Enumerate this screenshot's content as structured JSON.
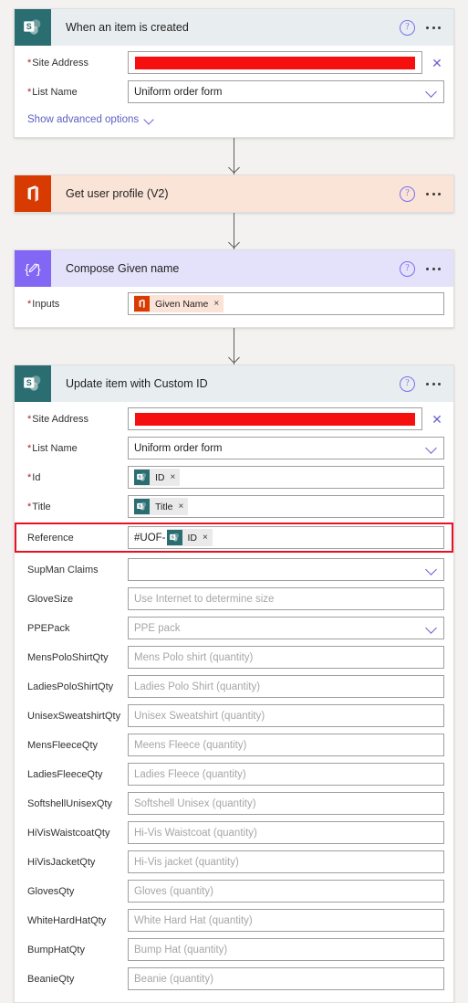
{
  "flow": {
    "steps": [
      {
        "id": "trigger",
        "title": "When an item is created",
        "connector": "sharepoint",
        "icon": "sharepoint-icon",
        "help_icon": "help-icon",
        "more_icon": "more-options-icon",
        "fields": [
          {
            "label": "Site Address",
            "required": true,
            "type": "redacted",
            "value": "",
            "placeholder": "",
            "clear_label": "✕"
          },
          {
            "label": "List Name",
            "required": true,
            "type": "dropdown",
            "value": "Uniform order form",
            "placeholder": ""
          }
        ],
        "advanced_label": "Show advanced options"
      },
      {
        "id": "get-user-profile",
        "title": "Get user profile (V2)",
        "connector": "office365",
        "icon": "office-365-icon",
        "help_icon": "help-icon",
        "more_icon": "more-options-icon",
        "fields": []
      },
      {
        "id": "compose-given-name",
        "title": "Compose Given name",
        "connector": "compose",
        "icon": "compose-icon",
        "help_icon": "help-icon",
        "more_icon": "more-options-icon",
        "fields": [
          {
            "label": "Inputs",
            "required": true,
            "type": "token",
            "token": {
              "text": "Given Name",
              "source": "office365",
              "remove_label": "×"
            }
          }
        ]
      },
      {
        "id": "update-item",
        "title": "Update item with Custom ID",
        "connector": "sharepoint",
        "icon": "sharepoint-icon",
        "help_icon": "help-icon",
        "more_icon": "more-options-icon",
        "fields": [
          {
            "label": "Site Address",
            "required": true,
            "type": "redacted",
            "value": "",
            "clear_label": "✕"
          },
          {
            "label": "List Name",
            "required": true,
            "type": "dropdown",
            "value": "Uniform order form"
          },
          {
            "label": "Id",
            "required": true,
            "type": "token",
            "token": {
              "text": "ID",
              "source": "sharepoint",
              "remove_label": "×"
            }
          },
          {
            "label": "Title",
            "required": true,
            "type": "token",
            "token": {
              "text": "Title",
              "source": "sharepoint",
              "remove_label": "×"
            }
          },
          {
            "label": "Reference",
            "required": false,
            "type": "token-with-prefix",
            "highlight": true,
            "prefix": "#UOF-",
            "token": {
              "text": "ID",
              "source": "sharepoint",
              "remove_label": "×"
            }
          },
          {
            "label": "SupMan Claims",
            "required": false,
            "type": "dropdown",
            "value": "",
            "placeholder": ""
          },
          {
            "label": "GloveSize",
            "required": false,
            "type": "text",
            "placeholder": "Use Internet to determine size"
          },
          {
            "label": "PPEPack",
            "required": false,
            "type": "dropdown",
            "value": "",
            "placeholder": "PPE pack"
          },
          {
            "label": "MensPoloShirtQty",
            "required": false,
            "type": "text",
            "placeholder": "Mens Polo shirt (quantity)"
          },
          {
            "label": "LadiesPoloShirtQty",
            "required": false,
            "type": "text",
            "placeholder": "Ladies Polo Shirt (quantity)"
          },
          {
            "label": "UnisexSweatshirtQty",
            "required": false,
            "type": "text",
            "placeholder": "Unisex Sweatshirt (quantity)"
          },
          {
            "label": "MensFleeceQty",
            "required": false,
            "type": "text",
            "placeholder": "Meens Fleece (quantity)"
          },
          {
            "label": "LadiesFleeceQty",
            "required": false,
            "type": "text",
            "placeholder": "Ladies Fleece (quantity)"
          },
          {
            "label": "SoftshellUnisexQty",
            "required": false,
            "type": "text",
            "placeholder": "Softshell Unisex (quantity)"
          },
          {
            "label": "HiVisWaistcoatQty",
            "required": false,
            "type": "text",
            "placeholder": "Hi-Vis Waistcoat (quantity)"
          },
          {
            "label": "HiVisJacketQty",
            "required": false,
            "type": "text",
            "placeholder": "Hi-Vis jacket (quantity)"
          },
          {
            "label": "GlovesQty",
            "required": false,
            "type": "text",
            "placeholder": "Gloves (quantity)"
          },
          {
            "label": "WhiteHardHatQty",
            "required": false,
            "type": "text",
            "placeholder": "White Hard Hat (quantity)"
          },
          {
            "label": "BumpHatQty",
            "required": false,
            "type": "text",
            "placeholder": "Bump Hat (quantity)"
          },
          {
            "label": "BeanieQty",
            "required": false,
            "type": "text",
            "placeholder": "Beanie (quantity)"
          }
        ]
      }
    ]
  },
  "colors": {
    "sharepoint": "#2a6e72",
    "sharepoint_header": "#e8eef0",
    "office365": "#d83b01",
    "office365_header": "#fae3d7",
    "compose": "#8267f5",
    "compose_header": "#e4e1fb",
    "required_asterisk": "#a4262c",
    "highlight_border": "#e81123",
    "redaction": "#f60f0f",
    "link": "#5b5fc7",
    "page_background": "#f3f2f1"
  }
}
